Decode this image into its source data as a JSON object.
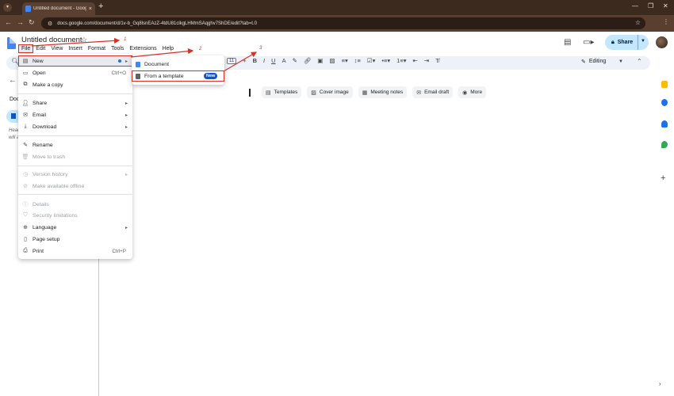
{
  "browser": {
    "tab_title": "Untitled document - Google Do",
    "url": "docs.google.com/document/d/1v-b_Gq8lsnEAzZ-4tdU81clkgLHMmSAqghv7ShDE/edit?tab=t.0"
  },
  "docs_header": {
    "title": "Untitled document",
    "share_label": "Share"
  },
  "menubar": [
    "File",
    "Edit",
    "View",
    "Insert",
    "Format",
    "Tools",
    "Extensions",
    "Help"
  ],
  "toolbar": {
    "font_size": "11",
    "mode_label": "Editing"
  },
  "left_panel": {
    "doc_tabs": "Docu",
    "hint_line1": "Head",
    "hint_line2": "will a"
  },
  "page_chips": [
    "Templates",
    "Cover image",
    "Meeting notes",
    "Email draft",
    "More"
  ],
  "file_menu": {
    "new": "New",
    "open": "Open",
    "open_shortcut": "Ctrl+O",
    "make_copy": "Make a copy",
    "share": "Share",
    "email": "Email",
    "download": "Download",
    "rename": "Rename",
    "move_trash": "Move to trash",
    "version_history": "Version history",
    "offline": "Make available offline",
    "details": "Details",
    "security": "Security limitations",
    "language": "Language",
    "page_setup": "Page setup",
    "print": "Print",
    "print_shortcut": "Ctrl+P"
  },
  "submenu": {
    "document": "Document",
    "from_template": "From a template",
    "badge": "New"
  },
  "annotations": [
    "1",
    "2",
    "3"
  ],
  "colors": {
    "accent_red": "#d93025",
    "docs_blue": "#4285f4",
    "share_bg": "#c2e7ff",
    "toolbar_bg": "#edf2fa"
  }
}
